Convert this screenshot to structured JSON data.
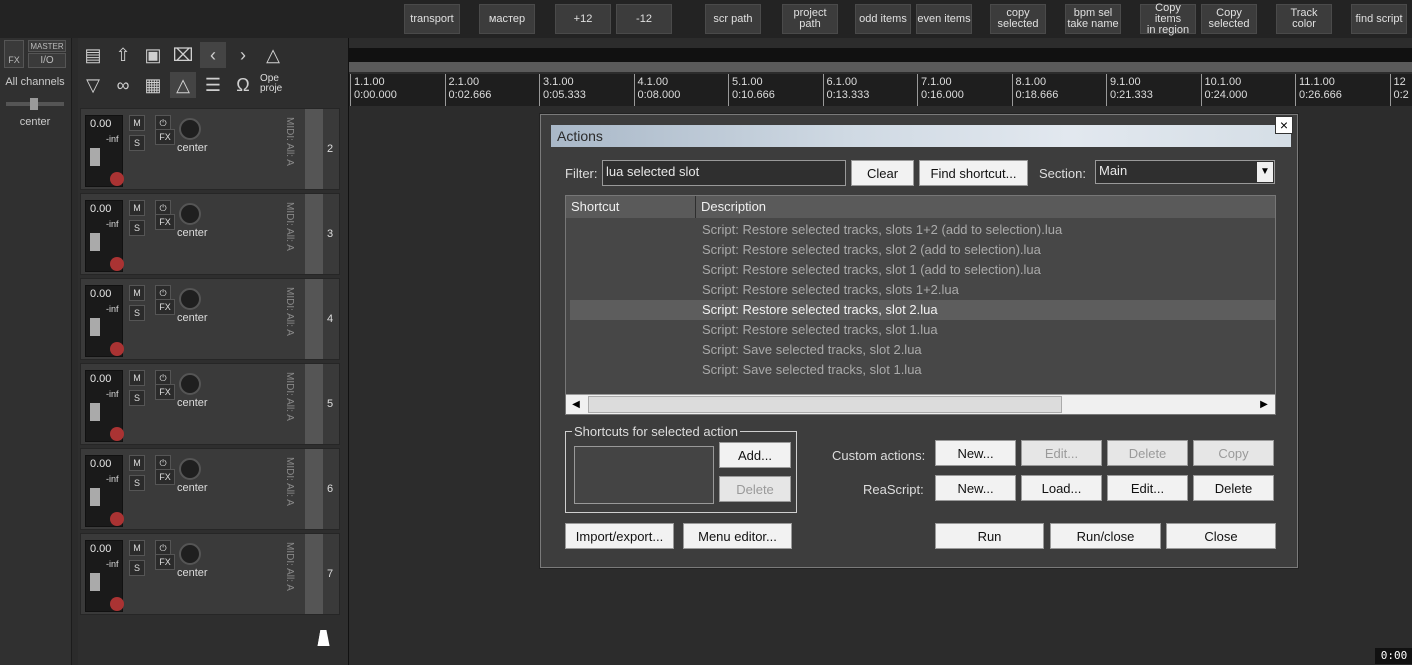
{
  "toolbar": {
    "buttons": [
      "transport",
      "мастер",
      "+12",
      "-12",
      "scr path",
      "project\npath",
      "odd items",
      "even items",
      "copy\nselected",
      "bpm sel\ntake name",
      "Copy items\nin region",
      "Copy\nselected",
      "Track\ncolor",
      "find script"
    ]
  },
  "master": {
    "fx_label": "FX",
    "master_label": "MASTER",
    "io_label": "I/O",
    "channels_label": "All channels",
    "pan_label": "center"
  },
  "tracks": [
    {
      "num": "2",
      "vol": "0.00",
      "inf": "-inf",
      "pan": "center",
      "midi": "MIDI: All: A"
    },
    {
      "num": "3",
      "vol": "0.00",
      "inf": "-inf",
      "pan": "center",
      "midi": "MIDI: All: A"
    },
    {
      "num": "4",
      "vol": "0.00",
      "inf": "-inf",
      "pan": "center",
      "midi": "MIDI: All: A"
    },
    {
      "num": "5",
      "vol": "0.00",
      "inf": "-inf",
      "pan": "center",
      "midi": "MIDI: All: A"
    },
    {
      "num": "6",
      "vol": "0.00",
      "inf": "-inf",
      "pan": "center",
      "midi": "MIDI: All: A"
    },
    {
      "num": "7",
      "vol": "0.00",
      "inf": "-inf",
      "pan": "center",
      "midi": "MIDI: All: A"
    }
  ],
  "track_buttons": {
    "mute": "M",
    "solo": "S",
    "fx": "FX"
  },
  "panel": {
    "open_label": "Ope\nproje"
  },
  "ruler": [
    {
      "bar": "1.1.00",
      "time": "0:00.000"
    },
    {
      "bar": "2.1.00",
      "time": "0:02.666"
    },
    {
      "bar": "3.1.00",
      "time": "0:05.333"
    },
    {
      "bar": "4.1.00",
      "time": "0:08.000"
    },
    {
      "bar": "5.1.00",
      "time": "0:10.666"
    },
    {
      "bar": "6.1.00",
      "time": "0:13.333"
    },
    {
      "bar": "7.1.00",
      "time": "0:16.000"
    },
    {
      "bar": "8.1.00",
      "time": "0:18.666"
    },
    {
      "bar": "9.1.00",
      "time": "0:21.333"
    },
    {
      "bar": "10.1.00",
      "time": "0:24.000"
    },
    {
      "bar": "11.1.00",
      "time": "0:26.666"
    },
    {
      "bar": "12",
      "time": "0:2"
    }
  ],
  "clock": "0:00",
  "dialog": {
    "title": "Actions",
    "close_glyph": "×",
    "filter_label": "Filter:",
    "filter_value": "lua selected slot",
    "clear_label": "Clear",
    "find_shortcut_label": "Find shortcut...",
    "section_label": "Section:",
    "section_value": "Main",
    "col_shortcut": "Shortcut",
    "col_description": "Description",
    "rows": [
      "Script: Restore selected tracks, slots 1+2 (add to selection).lua",
      "Script: Restore selected tracks, slot 2 (add to selection).lua",
      "Script: Restore selected tracks, slot 1 (add to selection).lua",
      "Script: Restore selected tracks, slots 1+2.lua",
      "Script: Restore selected tracks, slot 2.lua",
      "Script: Restore selected tracks, slot 1.lua",
      "Script: Save selected tracks, slot 2.lua",
      "Script: Save selected tracks, slot 1.lua"
    ],
    "selected_row": 4,
    "shortcuts_group": "Shortcuts for selected action",
    "add_label": "Add...",
    "delete_shortcut_label": "Delete",
    "custom_actions_label": "Custom actions:",
    "custom_new": "New...",
    "custom_edit": "Edit...",
    "custom_delete": "Delete",
    "custom_copy": "Copy",
    "reascript_label": "ReaScript:",
    "rs_new": "New...",
    "rs_load": "Load...",
    "rs_edit": "Edit...",
    "rs_delete": "Delete",
    "import_export_label": "Import/export...",
    "menu_editor_label": "Menu editor...",
    "run_label": "Run",
    "run_close_label": "Run/close",
    "close_label": "Close"
  }
}
